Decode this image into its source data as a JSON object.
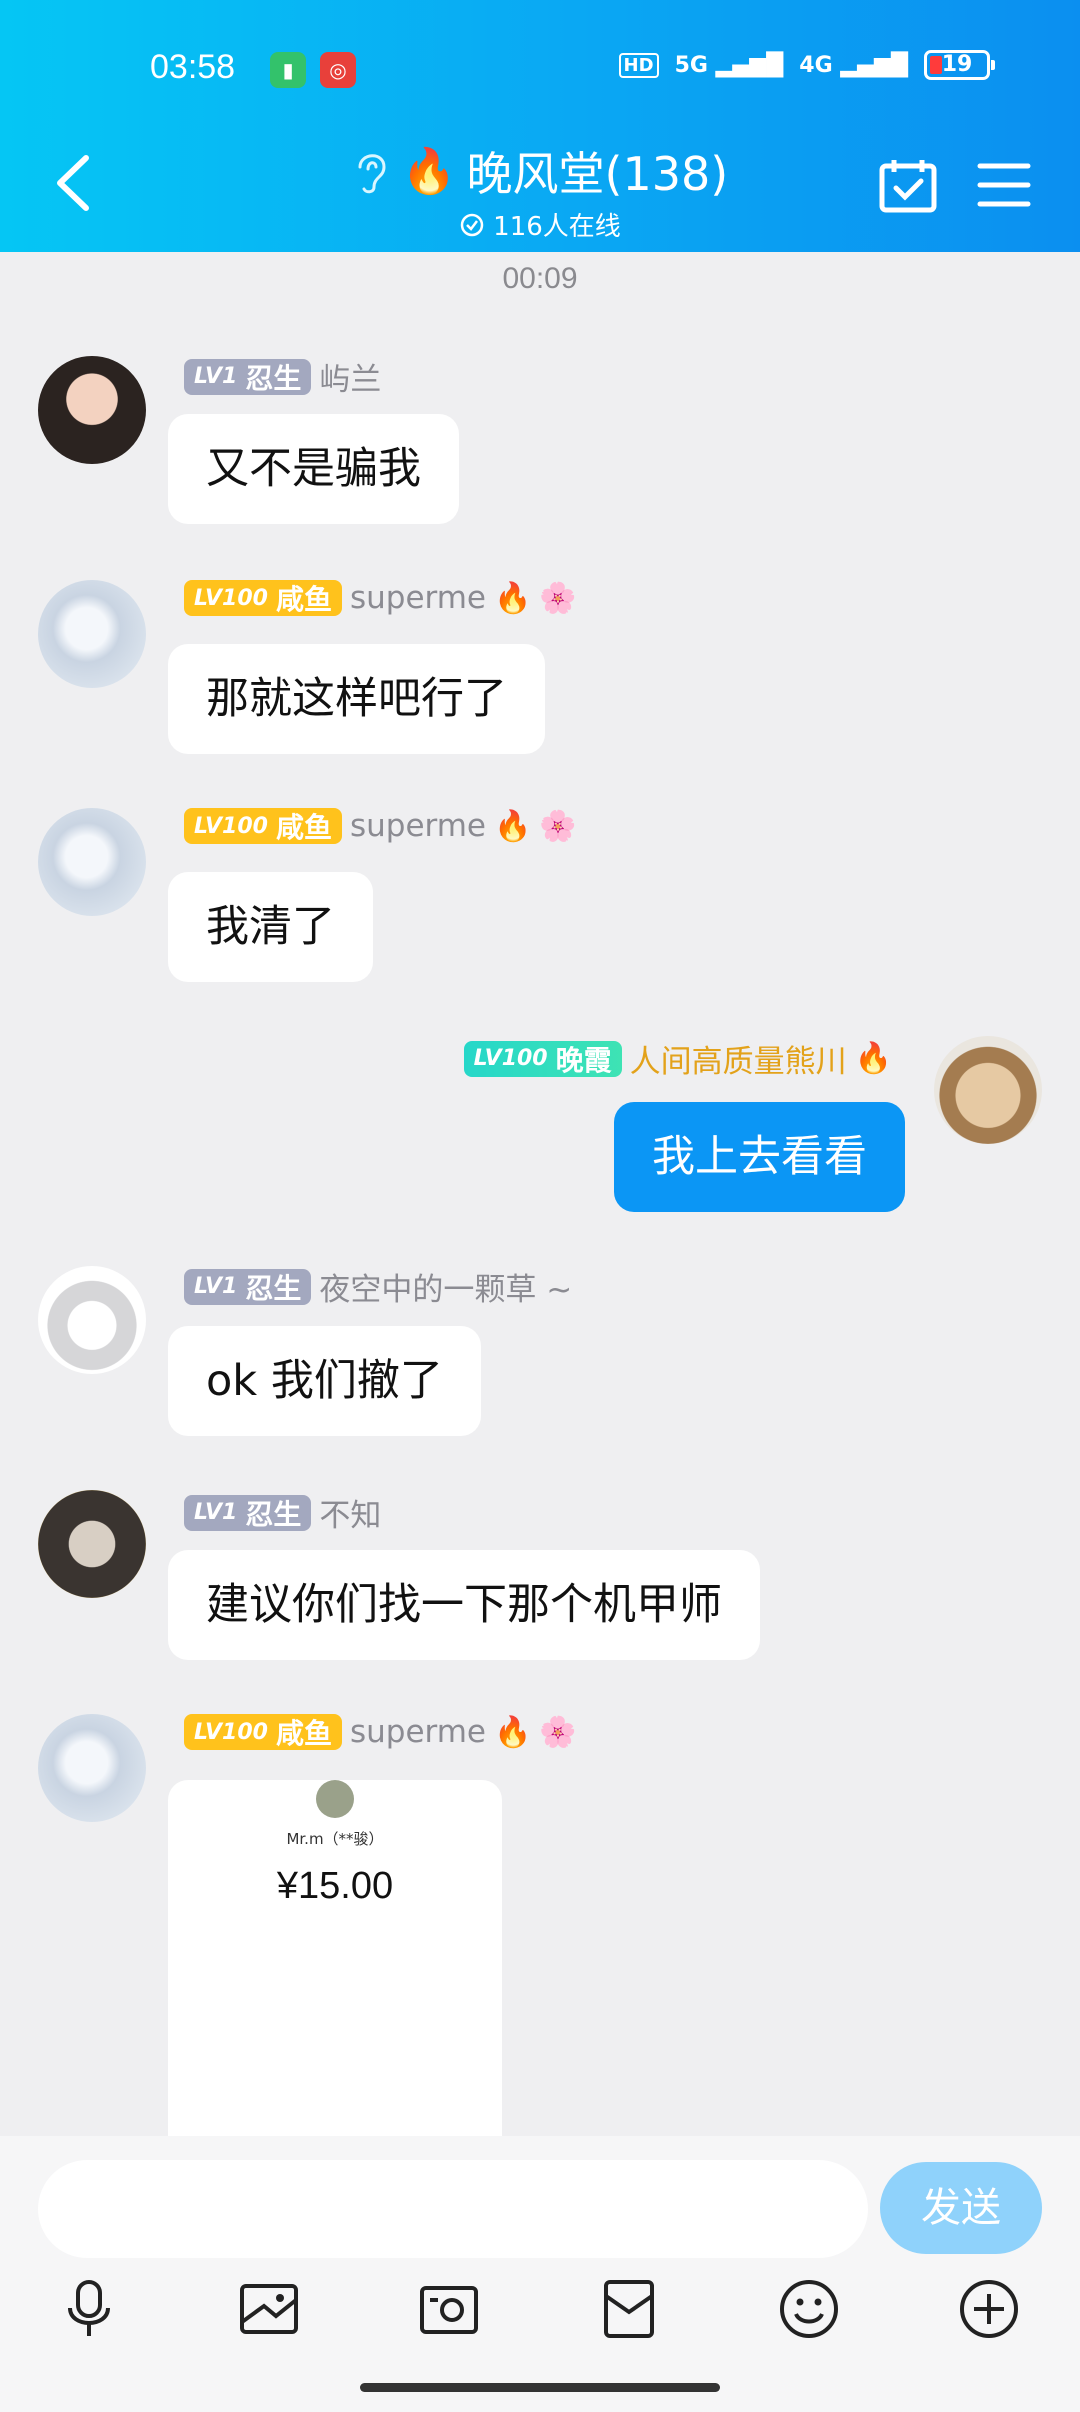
{
  "status_bar": {
    "time": "03:58",
    "network_hd": "HD",
    "network_5g": "5G",
    "network_4g": "4G",
    "battery": "19"
  },
  "header": {
    "title": "晚风堂(138)",
    "online_text": "116人在线"
  },
  "timestamp": "00:09",
  "messages": [
    {
      "level": "LV1",
      "rank": "忍生",
      "name": "屿兰",
      "text": "又不是骗我"
    },
    {
      "level": "LV100",
      "rank": "咸鱼",
      "name": "superme",
      "text": "那就这样吧行了"
    },
    {
      "level": "LV100",
      "rank": "咸鱼",
      "name": "superme",
      "text": "我清了"
    },
    {
      "level": "LV100",
      "rank": "晚霞",
      "name": "人间高质量熊川",
      "text": "我上去看看"
    },
    {
      "level": "LV1",
      "rank": "忍生",
      "name": "夜空中的一颗草 ~",
      "text": "ok 我们撤了"
    },
    {
      "level": "LV1",
      "rank": "忍生",
      "name": "不知",
      "text": "建议你们找一下那个机甲师"
    },
    {
      "level": "LV100",
      "rank": "咸鱼",
      "name": "superme",
      "text": ""
    }
  ],
  "payment": {
    "payer": "Mr.m（**骏）",
    "amount": "¥15.00"
  },
  "input": {
    "placeholder": "",
    "send_label": "发送"
  },
  "colors": {
    "header_start": "#05c6f4",
    "header_end": "#0b8ff0",
    "self_bubble": "#0b96f5",
    "send_button": "#8fd2fb"
  }
}
